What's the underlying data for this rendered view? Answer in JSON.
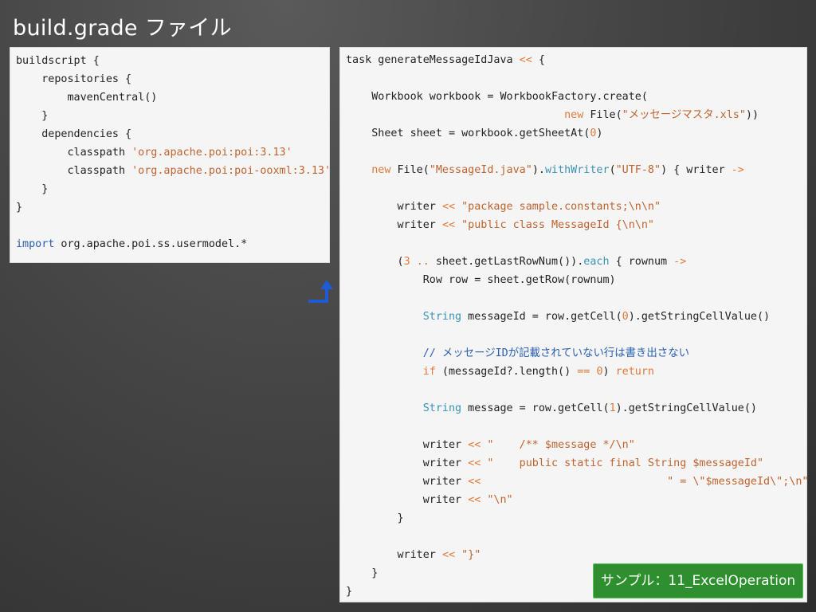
{
  "slide": {
    "title": "build.grade ファイル",
    "badge": "サンプル：11_ExcelOperation",
    "colors": {
      "keyword": "#e07a3c",
      "string": "#c0632f",
      "method": "#3a93b6",
      "comment": "#2a5fb0",
      "badge_bg": "#2d8f2d"
    }
  },
  "left_code": {
    "lines": [
      [
        {
          "t": "buildscript {",
          "c": "plain"
        }
      ],
      [
        {
          "t": "    repositories {",
          "c": "plain"
        }
      ],
      [
        {
          "t": "        mavenCentral()",
          "c": "plain"
        }
      ],
      [
        {
          "t": "    }",
          "c": "plain"
        }
      ],
      [
        {
          "t": "    dependencies {",
          "c": "plain"
        }
      ],
      [
        {
          "t": "        classpath ",
          "c": "plain"
        },
        {
          "t": "'org.apache.poi:poi:3.13'",
          "c": "str"
        }
      ],
      [
        {
          "t": "        classpath ",
          "c": "plain"
        },
        {
          "t": "'org.apache.poi:poi-ooxml:3.13'",
          "c": "str"
        }
      ],
      [
        {
          "t": "    }",
          "c": "plain"
        }
      ],
      [
        {
          "t": "}",
          "c": "plain"
        }
      ],
      [],
      [
        {
          "t": "import",
          "c": "import-kw"
        },
        {
          "t": " org.apache.poi.ss.usermodel.*",
          "c": "plain"
        }
      ]
    ],
    "arrow_icon": "return-arrow-icon"
  },
  "right_code": {
    "lines": [
      [
        {
          "t": "task generateMessageIdJava ",
          "c": "plain"
        },
        {
          "t": "<<",
          "c": "op"
        },
        {
          "t": " {",
          "c": "plain"
        }
      ],
      [],
      [
        {
          "t": "    Workbook workbook = WorkbookFactory.create(",
          "c": "plain"
        }
      ],
      [
        {
          "t": "                                  ",
          "c": "plain"
        },
        {
          "t": "new",
          "c": "kw"
        },
        {
          "t": " File(",
          "c": "plain"
        },
        {
          "t": "\"メッセージマスタ.xls\"",
          "c": "str"
        },
        {
          "t": "))",
          "c": "plain"
        }
      ],
      [
        {
          "t": "    Sheet sheet = workbook.getSheetAt(",
          "c": "plain"
        },
        {
          "t": "0",
          "c": "num"
        },
        {
          "t": ")",
          "c": "plain"
        }
      ],
      [],
      [
        {
          "t": "    ",
          "c": "plain"
        },
        {
          "t": "new",
          "c": "kw"
        },
        {
          "t": " File(",
          "c": "plain"
        },
        {
          "t": "\"MessageId.java\"",
          "c": "str"
        },
        {
          "t": ").",
          "c": "plain"
        },
        {
          "t": "withWriter",
          "c": "fn"
        },
        {
          "t": "(",
          "c": "plain"
        },
        {
          "t": "\"UTF-8\"",
          "c": "str"
        },
        {
          "t": ") { writer ",
          "c": "plain"
        },
        {
          "t": "->",
          "c": "op"
        }
      ],
      [],
      [
        {
          "t": "        writer ",
          "c": "plain"
        },
        {
          "t": "<<",
          "c": "op"
        },
        {
          "t": " ",
          "c": "plain"
        },
        {
          "t": "\"package sample.constants;\\n\\n\"",
          "c": "str"
        }
      ],
      [
        {
          "t": "        writer ",
          "c": "plain"
        },
        {
          "t": "<<",
          "c": "op"
        },
        {
          "t": " ",
          "c": "plain"
        },
        {
          "t": "\"public class MessageId {\\n\\n\"",
          "c": "str"
        }
      ],
      [],
      [
        {
          "t": "        (",
          "c": "plain"
        },
        {
          "t": "3",
          "c": "num"
        },
        {
          "t": " ",
          "c": "plain"
        },
        {
          "t": "..",
          "c": "op"
        },
        {
          "t": " sheet.getLastRowNum()).",
          "c": "plain"
        },
        {
          "t": "each",
          "c": "fn"
        },
        {
          "t": " { rownum ",
          "c": "plain"
        },
        {
          "t": "->",
          "c": "op"
        }
      ],
      [
        {
          "t": "            Row row = sheet.getRow(rownum)",
          "c": "plain"
        }
      ],
      [],
      [
        {
          "t": "            ",
          "c": "plain"
        },
        {
          "t": "String",
          "c": "fn"
        },
        {
          "t": " messageId = row.getCell(",
          "c": "plain"
        },
        {
          "t": "0",
          "c": "num"
        },
        {
          "t": ").getStringCellValue()",
          "c": "plain"
        }
      ],
      [],
      [
        {
          "t": "            // メッセージIDが記載されていない行は書き出さない",
          "c": "cmt"
        }
      ],
      [
        {
          "t": "            ",
          "c": "plain"
        },
        {
          "t": "if",
          "c": "kw"
        },
        {
          "t": " (messageId?.length() ",
          "c": "plain"
        },
        {
          "t": "==",
          "c": "op"
        },
        {
          "t": " ",
          "c": "plain"
        },
        {
          "t": "0",
          "c": "num"
        },
        {
          "t": ") ",
          "c": "plain"
        },
        {
          "t": "return",
          "c": "kw"
        }
      ],
      [],
      [
        {
          "t": "            ",
          "c": "plain"
        },
        {
          "t": "String",
          "c": "fn"
        },
        {
          "t": " message = row.getCell(",
          "c": "plain"
        },
        {
          "t": "1",
          "c": "num"
        },
        {
          "t": ").getStringCellValue()",
          "c": "plain"
        }
      ],
      [],
      [
        {
          "t": "            writer ",
          "c": "plain"
        },
        {
          "t": "<<",
          "c": "op"
        },
        {
          "t": " ",
          "c": "plain"
        },
        {
          "t": "\"    /** $message */\\n\"",
          "c": "str"
        }
      ],
      [
        {
          "t": "            writer ",
          "c": "plain"
        },
        {
          "t": "<<",
          "c": "op"
        },
        {
          "t": " ",
          "c": "plain"
        },
        {
          "t": "\"    public static final String $messageId\"",
          "c": "str"
        }
      ],
      [
        {
          "t": "            writer ",
          "c": "plain"
        },
        {
          "t": "<<",
          "c": "op"
        },
        {
          "t": "                             ",
          "c": "plain"
        },
        {
          "t": "\" = \\\"$messageId\\\";\\n\"",
          "c": "str"
        }
      ],
      [
        {
          "t": "            writer ",
          "c": "plain"
        },
        {
          "t": "<<",
          "c": "op"
        },
        {
          "t": " ",
          "c": "plain"
        },
        {
          "t": "\"\\n\"",
          "c": "str"
        }
      ],
      [
        {
          "t": "        }",
          "c": "plain"
        }
      ],
      [],
      [
        {
          "t": "        writer ",
          "c": "plain"
        },
        {
          "t": "<<",
          "c": "op"
        },
        {
          "t": " ",
          "c": "plain"
        },
        {
          "t": "\"}\"",
          "c": "str"
        }
      ],
      [
        {
          "t": "    }",
          "c": "plain"
        }
      ],
      [
        {
          "t": "}",
          "c": "plain"
        }
      ]
    ]
  }
}
